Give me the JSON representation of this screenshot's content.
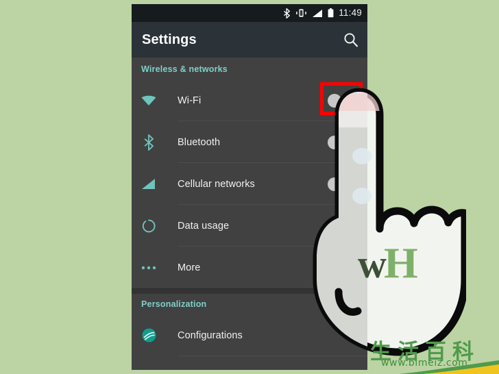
{
  "background_color": "#bcd3a4",
  "phone": {
    "status_bar": {
      "background": "#161b1e",
      "clock": "11:49",
      "icons": [
        "bluetooth-icon",
        "vibrate-icon",
        "signal-icon",
        "battery-icon"
      ]
    },
    "toolbar": {
      "background": "#2b3338",
      "title": "Settings",
      "search_icon": "search-icon"
    },
    "accent_color": "#7fd0c8",
    "sections": [
      {
        "header": "Wireless & networks",
        "rows": [
          {
            "label": "Wi-Fi",
            "icon": "wifi-icon",
            "toggle": true,
            "highlighted": true
          },
          {
            "label": "Bluetooth",
            "icon": "bluetooth-icon",
            "toggle": true,
            "highlighted": false
          },
          {
            "label": "Cellular networks",
            "icon": "signal-icon",
            "toggle": true,
            "highlighted": false
          },
          {
            "label": "Data usage",
            "icon": "data-usage-icon",
            "toggle": false,
            "highlighted": false
          },
          {
            "label": "More",
            "icon": "more-dots-icon",
            "toggle": false,
            "highlighted": false
          }
        ]
      },
      {
        "header": "Personalization",
        "rows": [
          {
            "label": "Configurations",
            "icon": "configurations-icon",
            "toggle": false,
            "highlighted": false
          }
        ]
      }
    ],
    "highlight_color": "#ff0000"
  },
  "cursor": {
    "type": "pointing-hand-cursor",
    "logo_first": "w",
    "logo_second": "H",
    "logo_first_color": "#3c4f38",
    "logo_second_color": "#7fb069"
  },
  "watermark": {
    "chinese_text": "生活百科",
    "url": "www.bimeiz.com",
    "color": "#4f9b4b"
  }
}
